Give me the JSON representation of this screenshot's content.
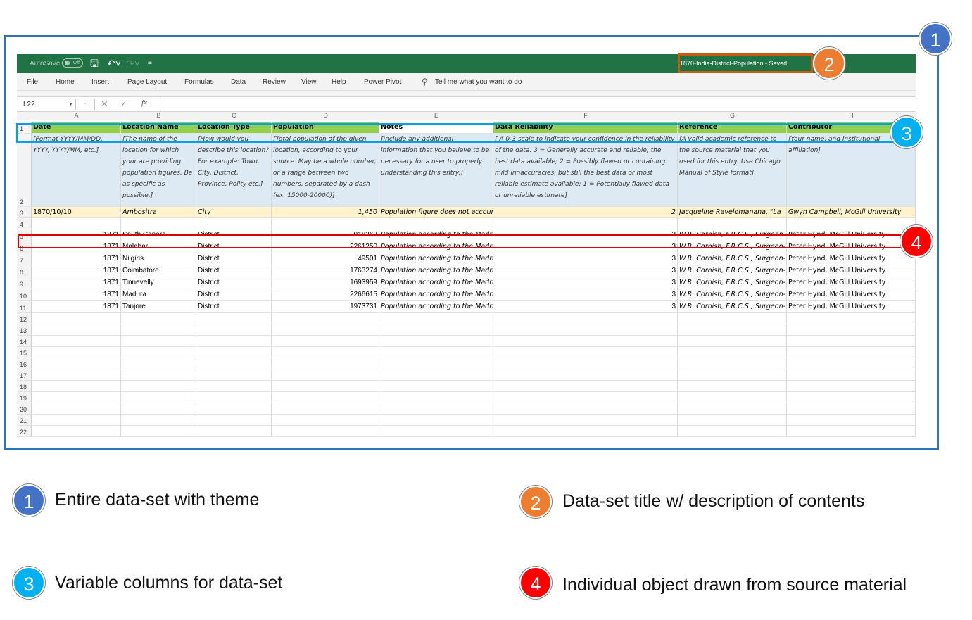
{
  "window": {
    "autosave_label": "AutoSave",
    "autosave_state": "Off",
    "title": "1870-India-District-Population  -  Saved"
  },
  "menu": [
    "File",
    "Home",
    "Insert",
    "Page Layout",
    "Formulas",
    "Data",
    "Review",
    "View",
    "Help",
    "Power Pivot"
  ],
  "tell_me": "Tell me what you want to do",
  "name_box": "L22",
  "column_letters": [
    "A",
    "B",
    "C",
    "D",
    "E",
    "F",
    "G",
    "H"
  ],
  "headers": [
    "Date",
    "Location Name",
    "Location Type",
    "Population",
    "Notes",
    "Data Reliability",
    "Reference",
    "Contributor"
  ],
  "descriptions": [
    "[Format YYYY/MM/DD, YYYY, YYYY/MM, etc.]",
    "[The name of the location for which your are providing population figures. Be as specific as possible.]",
    "[How would you describe this location? For example: Town, City, District, Province, Polity etc.]",
    "[Total population of the given location, according to your source. May be a whole number, or a range between two numbers, separated by a dash (ex. 15000-20000)]",
    "[Include any additional information that you believe to be necessary for a user to properly understanding this entry.]",
    "[ A 0-3 scale  to indicate your confidence in the reliability of the data. 3 = Generally accurate and reliable, the best data available; 2 = Possibly flawed or containing mild innaccuracies, but still the best data or most reliable estimate available; 1 = Potentially flawed data or unreliable estimate]",
    "[A valid academic reference to the source material that you used for this entry. Use Chicago Manual of Style format]",
    "[Your name, and institutional affiliation]"
  ],
  "example_row": [
    "1870/10/10",
    "Ambositra",
    "City",
    "1,450",
    "Population figure does not account",
    "2",
    "Jacqueline Ravelomanana, \"La",
    "Gwyn Campbell, McGill University"
  ],
  "data_rows": [
    [
      "1871",
      "South Canara",
      "District",
      "918362",
      "Population according to the Madras",
      "3",
      "W.R. Cornish, F.R.C.S., Surgeon-",
      "Peter Hynd, McGill University"
    ],
    [
      "1871",
      "Malabar",
      "District",
      "2261250",
      "Population according to the Madras",
      "3",
      "W.R. Cornish, F.R.C.S., Surgeon-",
      "Peter Hynd, McGill University"
    ],
    [
      "1871",
      "Nilgiris",
      "District",
      "49501",
      "Population according to the Madras",
      "3",
      "W.R. Cornish, F.R.C.S., Surgeon-",
      "Peter Hynd, McGill University"
    ],
    [
      "1871",
      "Coimbatore",
      "District",
      "1763274",
      "Population according to the Madras",
      "3",
      "W.R. Cornish, F.R.C.S., Surgeon-",
      "Peter Hynd, McGill University"
    ],
    [
      "1871",
      "Tinnevelly",
      "District",
      "1693959",
      "Population according to the Madras",
      "3",
      "W.R. Cornish, F.R.C.S., Surgeon-",
      "Peter Hynd, McGill University"
    ],
    [
      "1871",
      "Madura",
      "District",
      "2266615",
      "Population according to the Madras",
      "3",
      "W.R. Cornish, F.R.C.S., Surgeon-",
      "Peter Hynd, McGill University"
    ],
    [
      "1871",
      "Tanjore",
      "District",
      "1973731",
      "Population according to the Madras",
      "3",
      "W.R. Cornish, F.R.C.S., Surgeon-",
      "Peter Hynd, McGill University"
    ]
  ],
  "row_numbers": [
    "1",
    "2",
    "3",
    "4",
    "5",
    "6",
    "7",
    "8",
    "9",
    "10",
    "11",
    "12",
    "13",
    "14",
    "15",
    "16",
    "17",
    "18",
    "19",
    "20",
    "21",
    "22"
  ],
  "badges": [
    "1",
    "2",
    "3",
    "4"
  ],
  "legend": [
    {
      "num": "1",
      "text": "Entire data-set with theme"
    },
    {
      "num": "2",
      "text": "Data-set title w/ description of contents"
    },
    {
      "num": "3",
      "text": "Variable columns for data-set"
    },
    {
      "num": "4",
      "text": "Individual object drawn from source material"
    }
  ],
  "colors": {
    "excel_green": "#217346",
    "header_green": "#92d050",
    "description_blue": "#dde9f3",
    "example_yellow": "#fff2cc",
    "badge1": "#4472c4",
    "badge2": "#ed7d31",
    "badge3": "#00b0f0",
    "badge4": "#ff0000"
  }
}
